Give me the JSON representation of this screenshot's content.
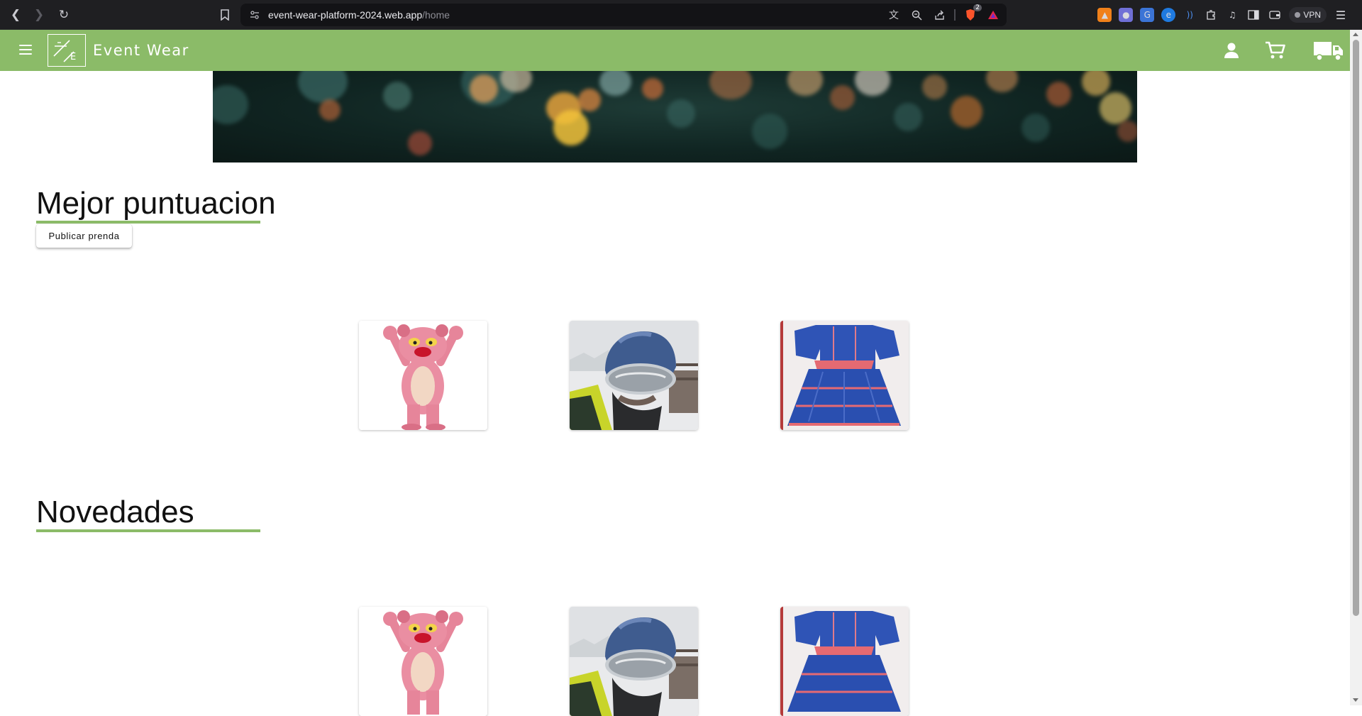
{
  "browser": {
    "url_host": "event-wear-platform-2024.web.app",
    "url_path": "/home",
    "shields_badge": "2",
    "vpn_label": "VPN"
  },
  "header": {
    "brand_name": "Event Wear",
    "logo_letter": "E",
    "accent_color": "#8bbb68"
  },
  "sections": {
    "top_rated": {
      "title": "Mejor puntuacion",
      "publish_label": "Publicar prenda",
      "cards": [
        {
          "image": "pink-panther-costume"
        },
        {
          "image": "ski-helmet-selfie"
        },
        {
          "image": "blue-folk-dress"
        }
      ]
    },
    "new_arrivals": {
      "title": "Novedades",
      "cards": [
        {
          "image": "pink-panther-costume"
        },
        {
          "image": "ski-helmet-selfie"
        },
        {
          "image": "blue-folk-dress"
        }
      ]
    }
  }
}
